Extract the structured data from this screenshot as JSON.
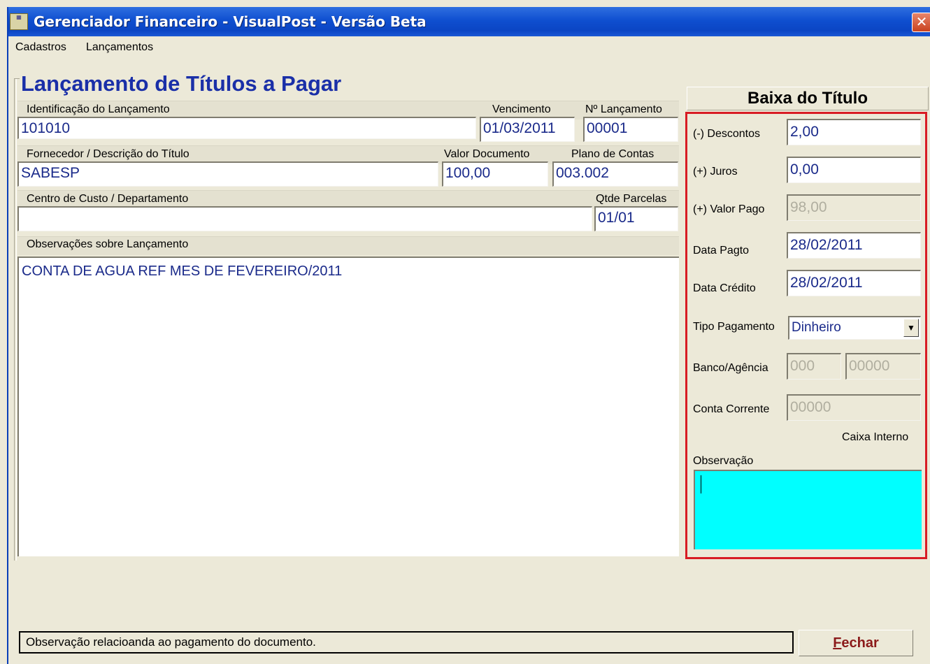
{
  "window": {
    "title": "Gerenciador Financeiro - VisualPost - Versão Beta",
    "icon": "app-icon",
    "close_glyph": "✕"
  },
  "menu": {
    "items": [
      "Cadastros",
      "Lançamentos"
    ]
  },
  "form": {
    "heading": "Lançamento de Títulos a Pagar",
    "identificacao": {
      "label": "Identificação do Lançamento",
      "value": "101010"
    },
    "vencimento": {
      "label": "Vencimento",
      "value": "01/03/2011"
    },
    "num_lancamento": {
      "label": "Nº Lançamento",
      "value": "00001"
    },
    "fornecedor": {
      "label": "Fornecedor / Descrição do Título",
      "value": "SABESP"
    },
    "valor_documento": {
      "label": "Valor Documento",
      "value": "100,00"
    },
    "plano_contas": {
      "label": "Plano de Contas",
      "value": "003.002"
    },
    "centro_custo": {
      "label": "Centro de Custo / Departamento",
      "value": ""
    },
    "qtde_parcelas": {
      "label": "Qtde Parcelas",
      "value": "01/01"
    },
    "observacoes": {
      "label": "Observações sobre Lançamento",
      "value": "CONTA DE AGUA REF MES DE FEVEREIRO/2011"
    }
  },
  "baixa": {
    "title": "Baixa do Título",
    "descontos": {
      "label": "(-) Descontos",
      "value": "2,00"
    },
    "juros": {
      "label": "(+) Juros",
      "value": "0,00"
    },
    "valor_pago": {
      "label": "(+) Valor Pago",
      "value": "98,00"
    },
    "data_pagto": {
      "label": "Data Pagto",
      "value": "28/02/2011"
    },
    "data_credito": {
      "label": "Data Crédito",
      "value": "28/02/2011"
    },
    "tipo_pagamento": {
      "label": "Tipo Pagamento",
      "value": "Dinheiro"
    },
    "banco_agencia": {
      "label": "Banco/Agência",
      "banco": "000",
      "agencia": "00000"
    },
    "conta_corrente": {
      "label": "Conta Corrente",
      "value": "00000"
    },
    "caixa_interno": "Caixa Interno",
    "observacao": {
      "label": "Observação",
      "value": ""
    },
    "highlight_color": "#d81c24",
    "obs_color": "#00ffff"
  },
  "footer": {
    "status": "Observação relacioanda ao pagamento do documento.",
    "close_mnemonic": "F",
    "close_rest": "echar"
  }
}
